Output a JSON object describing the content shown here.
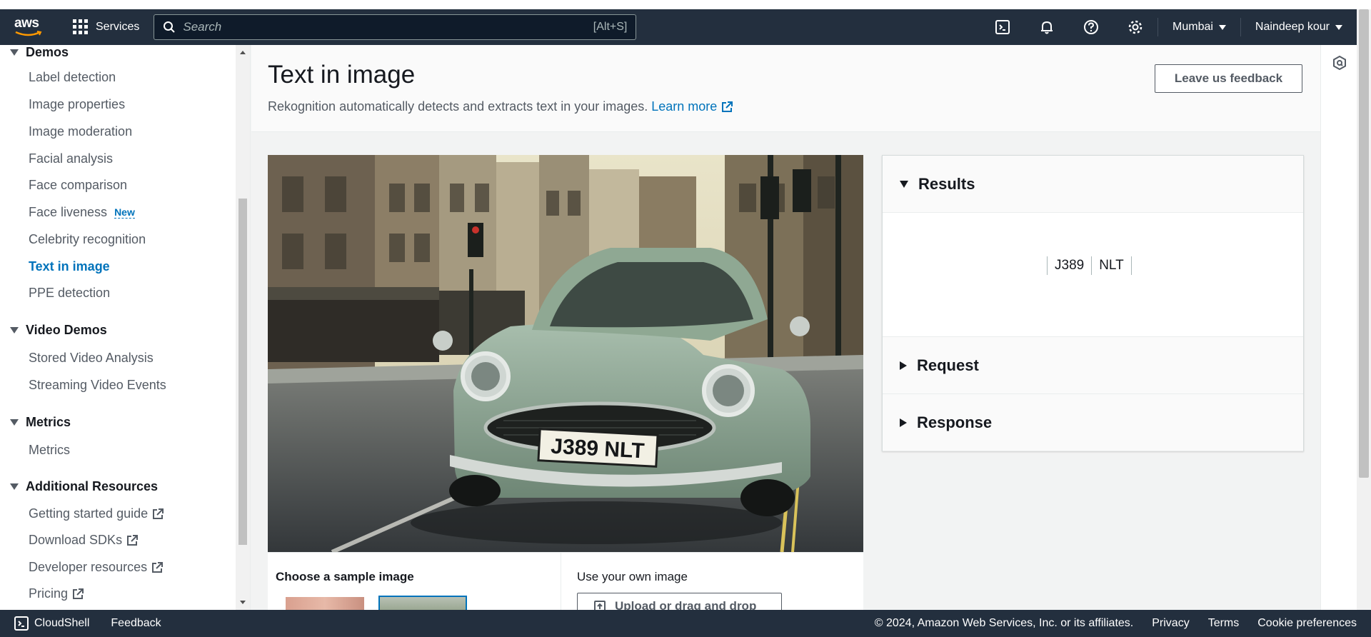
{
  "topnav": {
    "logo_text": "aws",
    "services_label": "Services",
    "search_placeholder": "Search",
    "search_shortcut": "[Alt+S]",
    "region": "Mumbai",
    "user": "Naindeep kour"
  },
  "sidebar": {
    "sections": [
      {
        "label": "Demos",
        "items": [
          "Label detection",
          "Image properties",
          "Image moderation",
          "Facial analysis",
          "Face comparison",
          "Face liveness",
          "Celebrity recognition",
          "Text in image",
          "PPE detection"
        ]
      },
      {
        "label": "Video Demos",
        "items": [
          "Stored Video Analysis",
          "Streaming Video Events"
        ]
      },
      {
        "label": "Metrics",
        "items": [
          "Metrics"
        ]
      },
      {
        "label": "Additional Resources",
        "items": [
          "Getting started guide",
          "Download SDKs",
          "Developer resources",
          "Pricing"
        ]
      }
    ],
    "new_badge": "New",
    "active_item": "Text in image"
  },
  "main": {
    "title": "Text in image",
    "description": "Rekognition automatically detects and extracts text in your images.",
    "learn_more": "Learn more",
    "feedback_button": "Leave us feedback",
    "choose_sample_label": "Choose a sample image",
    "own_image_label": "Use your own image",
    "upload_button": "Upload or drag and drop",
    "plate_text": "J389 NLT"
  },
  "results": {
    "results_label": "Results",
    "detected_words": [
      "J389",
      "NLT"
    ],
    "request_label": "Request",
    "response_label": "Response"
  },
  "footer": {
    "cloudshell": "CloudShell",
    "feedback": "Feedback",
    "copyright": "© 2024, Amazon Web Services, Inc. or its affiliates.",
    "privacy": "Privacy",
    "terms": "Terms",
    "cookies": "Cookie preferences"
  },
  "colors": {
    "nav_bg": "#232f3e",
    "link": "#0073bb",
    "car_green": "#8fa893"
  }
}
